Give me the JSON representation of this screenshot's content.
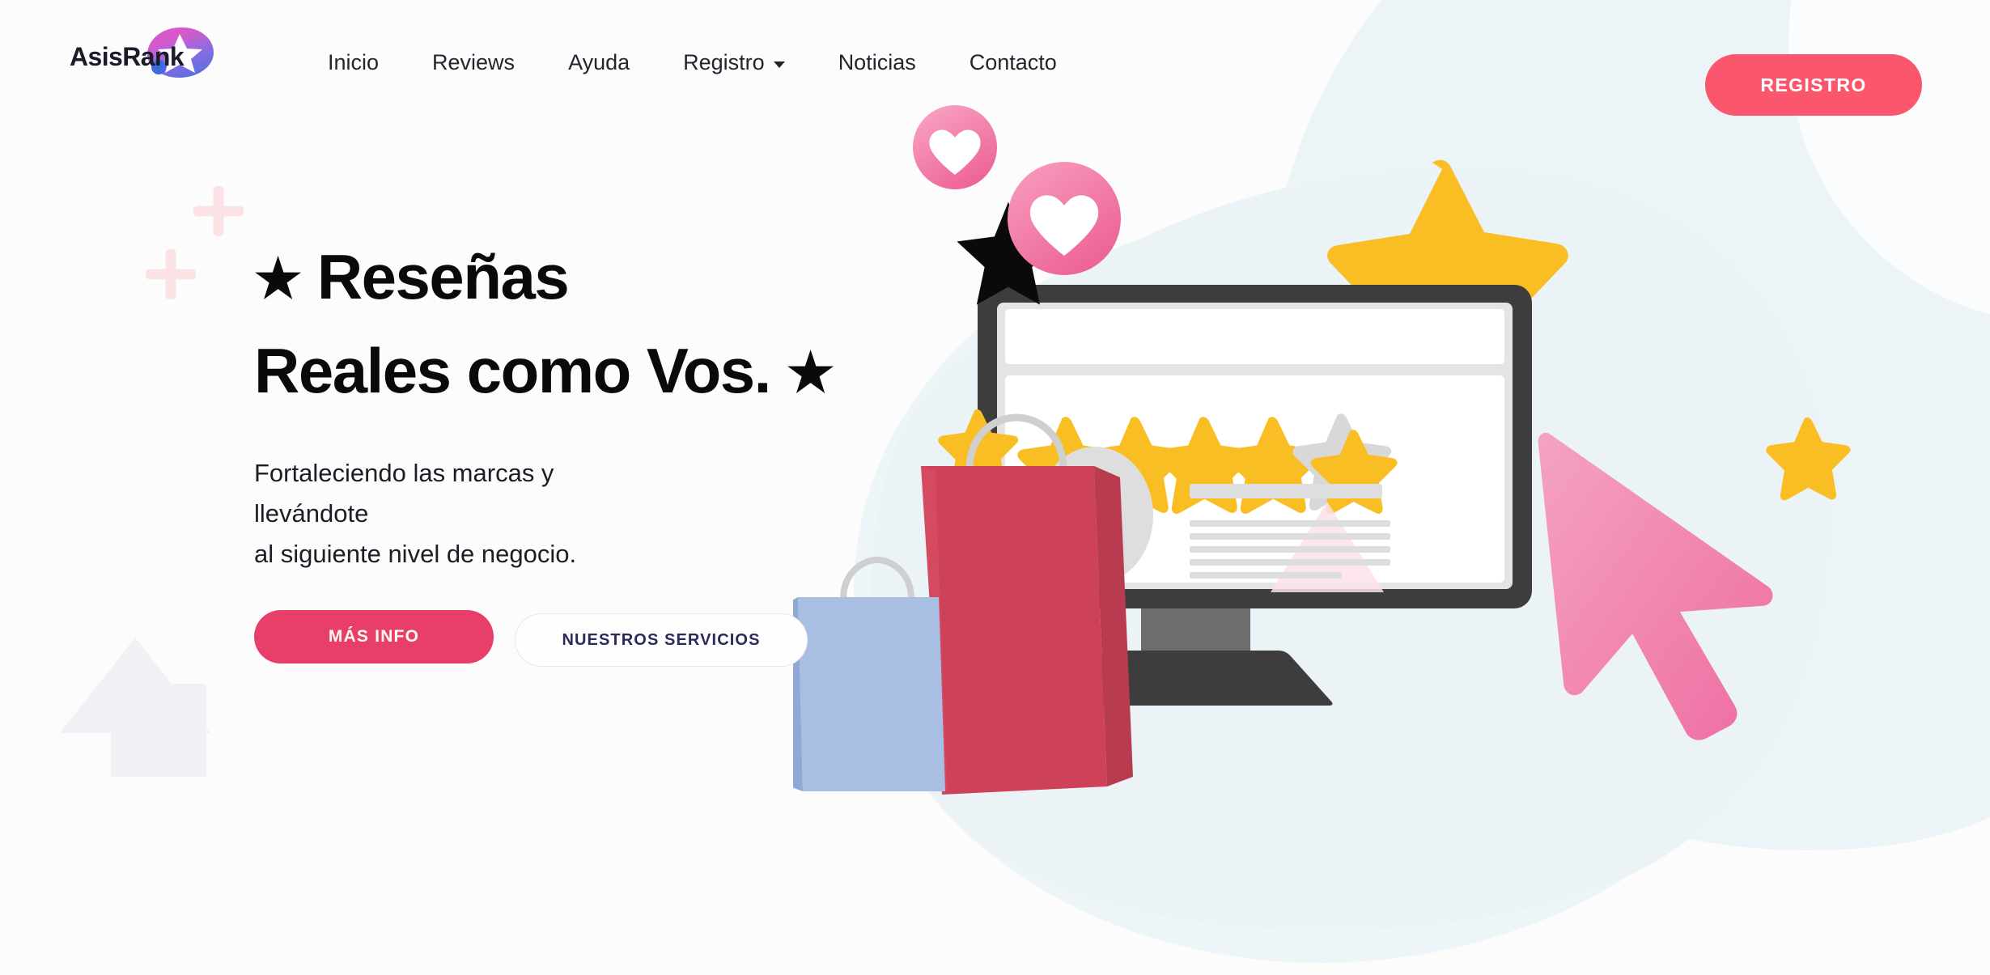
{
  "brand": {
    "logo_text": "AsisRank",
    "logo_icon": "star-blob-gradient-icon",
    "gradient_from": "#E353C9",
    "gradient_to": "#4A6FE0"
  },
  "nav": {
    "items": [
      {
        "label": "Inicio",
        "has_dropdown": false
      },
      {
        "label": "Reviews",
        "has_dropdown": false
      },
      {
        "label": "Ayuda",
        "has_dropdown": false
      },
      {
        "label": "Registro",
        "has_dropdown": true
      },
      {
        "label": "Noticias",
        "has_dropdown": false
      },
      {
        "label": "Contacto",
        "has_dropdown": false
      }
    ],
    "cta_label": "REGISTRO",
    "cta_color": "#FA566E"
  },
  "hero": {
    "headline_star_left": "★",
    "headline_line1": "Reseñas",
    "headline_line2": "Reales como Vos.",
    "headline_star_right": "★",
    "subtitle_line1": "Fortaleciendo las marcas y",
    "subtitle_line2": "llevándote",
    "subtitle_line3": "al siguiente nivel de negocio.",
    "primary_cta": "MÁS INFO",
    "primary_cta_color": "#E83E6A",
    "secondary_cta": "NUESTROS SERVICIOS",
    "secondary_cta_text_color": "#2A2A5C"
  },
  "illustration": {
    "rating_stars_filled": 4,
    "rating_stars_total": 5,
    "star_color": "#F9BE23",
    "empty_star_color": "#D8D8D8",
    "monitor_frame_color": "#3D3D3D",
    "cursor_color": "#F07CA8",
    "heart_badge_color": "#F178A8",
    "bag_red_color": "#CE4259",
    "bag_blue_color": "#A8BFE3",
    "background_blob_color": "#EDF4F7",
    "decor_plus_color": "#FBE3E5",
    "decor_shape_color": "#F0F1F5",
    "decor_icons": [
      "star-large-icon",
      "star-small-top-icon",
      "star-small-left-icon",
      "star-small-right-icon",
      "star-black-icon",
      "heart-badge-small-icon",
      "heart-badge-large-icon",
      "cursor-arrow-icon",
      "shopping-bag-red-icon",
      "shopping-bag-blue-icon",
      "monitor-icon",
      "avatar-placeholder",
      "plus-decor-icon",
      "triangle-decor-icon",
      "square-decor-icon"
    ]
  }
}
